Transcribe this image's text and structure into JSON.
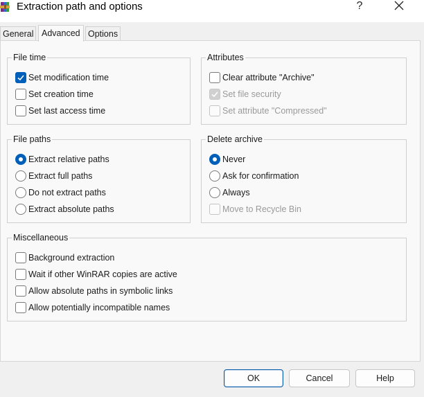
{
  "window": {
    "title": "Extraction path and options",
    "help_label": "?"
  },
  "tabs": [
    {
      "label": "General"
    },
    {
      "label": "Advanced"
    },
    {
      "label": "Options"
    }
  ],
  "active_tab": "Advanced",
  "file_time": {
    "label": "File time",
    "items": [
      {
        "label": "Set modification time",
        "checked": true
      },
      {
        "label": "Set creation time",
        "checked": false
      },
      {
        "label": "Set last access time",
        "checked": false
      }
    ]
  },
  "attributes": {
    "label": "Attributes",
    "items": [
      {
        "label": "Clear attribute \"Archive\"",
        "checked": false,
        "enabled": true
      },
      {
        "label": "Set file security",
        "checked": true,
        "enabled": false
      },
      {
        "label": "Set attribute \"Compressed\"",
        "checked": false,
        "enabled": false
      }
    ]
  },
  "file_paths": {
    "label": "File paths",
    "items": [
      {
        "label": "Extract relative paths",
        "selected": true
      },
      {
        "label": "Extract full paths",
        "selected": false
      },
      {
        "label": "Do not extract paths",
        "selected": false
      },
      {
        "label": "Extract absolute paths",
        "selected": false
      }
    ]
  },
  "delete_archive": {
    "label": "Delete archive",
    "items": [
      {
        "label": "Never",
        "selected": true
      },
      {
        "label": "Ask for confirmation",
        "selected": false
      },
      {
        "label": "Always",
        "selected": false
      }
    ],
    "recycle": {
      "label": "Move to Recycle Bin",
      "checked": false,
      "enabled": false
    }
  },
  "misc": {
    "label": "Miscellaneous",
    "items": [
      {
        "label": "Background extraction",
        "checked": false
      },
      {
        "label": "Wait if other WinRAR copies are active",
        "checked": false
      },
      {
        "label": "Allow absolute paths in symbolic links",
        "checked": false
      },
      {
        "label": "Allow potentially incompatible names",
        "checked": false
      }
    ]
  },
  "buttons": {
    "ok": "OK",
    "cancel": "Cancel",
    "help": "Help"
  },
  "colors": {
    "accent": "#005fb8",
    "panel_bg": "#f9f9f9",
    "window_bg": "#f0f0f0"
  },
  "icons": {
    "app": "winrar-books-icon",
    "close": "close-x-icon",
    "check": "checkmark-icon"
  }
}
